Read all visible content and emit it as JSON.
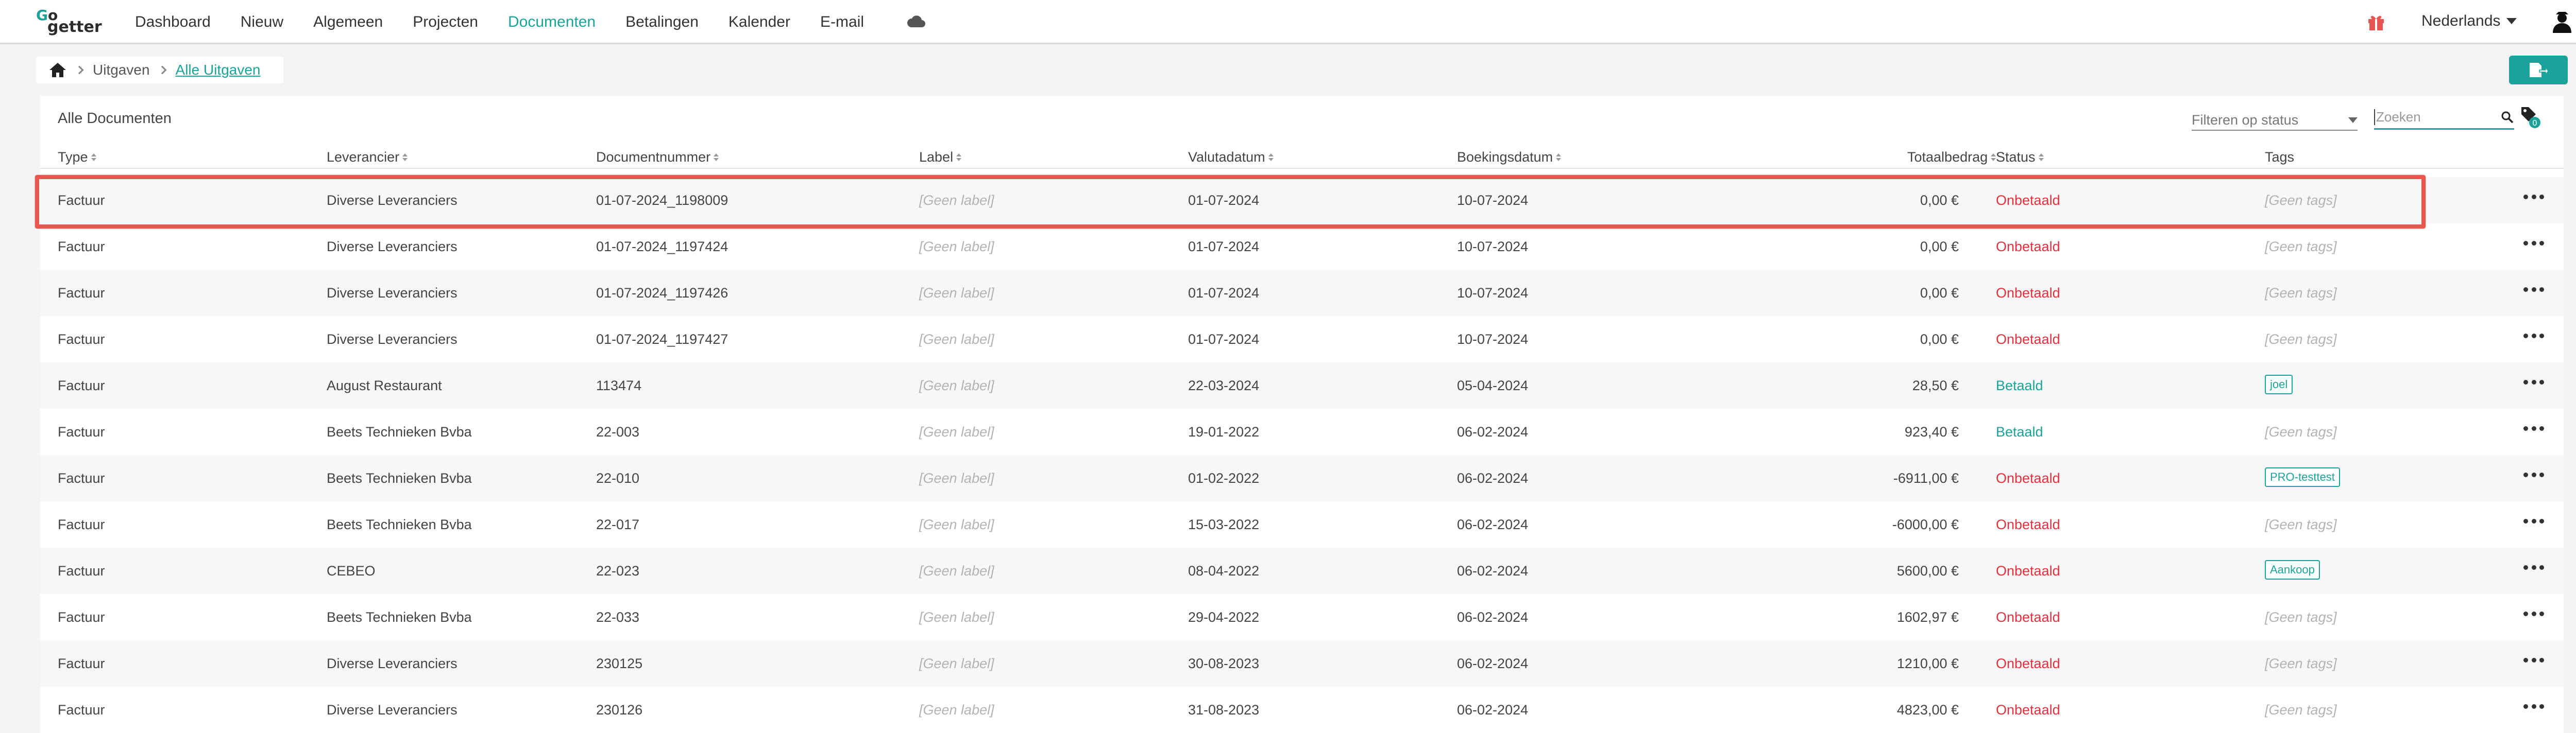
{
  "colors": {
    "accent": "#1aa39a",
    "unpaid": "#e2303e",
    "highlight": "#e85652"
  },
  "logo": {
    "line1_prefix": "G",
    "line1": "o",
    "line2": "getter"
  },
  "nav": {
    "items": [
      {
        "label": "Dashboard",
        "active": false
      },
      {
        "label": "Nieuw",
        "active": false
      },
      {
        "label": "Algemeen",
        "active": false
      },
      {
        "label": "Projecten",
        "active": false
      },
      {
        "label": "Documenten",
        "active": true
      },
      {
        "label": "Betalingen",
        "active": false
      },
      {
        "label": "Kalender",
        "active": false
      },
      {
        "label": "E-mail",
        "active": false
      }
    ],
    "cloud_icon": "cloud-icon",
    "gift_icon": "gift-icon",
    "language": "Nederlands",
    "user_icon": "user-icon"
  },
  "breadcrumb": {
    "home_icon": "home-icon",
    "items": [
      "Uitgaven",
      "Alle Uitgaven"
    ]
  },
  "export_icon": "export-icon",
  "card": {
    "title": "Alle Documenten",
    "filter_placeholder": "Filteren op status",
    "search_placeholder": "Zoeken",
    "tag_filter_count": "0"
  },
  "table": {
    "headers": [
      "Type",
      "Leverancier",
      "Documentnummer",
      "Label",
      "Valutadatum",
      "Boekingsdatum",
      "Totaalbedrag",
      "Status",
      "Tags"
    ],
    "rows": [
      {
        "type": "Factuur",
        "leverancier": "Diverse Leveranciers",
        "doc": "01-07-2024_1198009",
        "label": "[Geen label]",
        "valuta": "01-07-2024",
        "boeking": "10-07-2024",
        "totaal": "0,00 €",
        "status": "Onbetaald",
        "paid": false,
        "tag": "[Geen tags]",
        "has_tag": false
      },
      {
        "type": "Factuur",
        "leverancier": "Diverse Leveranciers",
        "doc": "01-07-2024_1197424",
        "label": "[Geen label]",
        "valuta": "01-07-2024",
        "boeking": "10-07-2024",
        "totaal": "0,00 €",
        "status": "Onbetaald",
        "paid": false,
        "tag": "[Geen tags]",
        "has_tag": false
      },
      {
        "type": "Factuur",
        "leverancier": "Diverse Leveranciers",
        "doc": "01-07-2024_1197426",
        "label": "[Geen label]",
        "valuta": "01-07-2024",
        "boeking": "10-07-2024",
        "totaal": "0,00 €",
        "status": "Onbetaald",
        "paid": false,
        "tag": "[Geen tags]",
        "has_tag": false
      },
      {
        "type": "Factuur",
        "leverancier": "Diverse Leveranciers",
        "doc": "01-07-2024_1197427",
        "label": "[Geen label]",
        "valuta": "01-07-2024",
        "boeking": "10-07-2024",
        "totaal": "0,00 €",
        "status": "Onbetaald",
        "paid": false,
        "tag": "[Geen tags]",
        "has_tag": false
      },
      {
        "type": "Factuur",
        "leverancier": "August Restaurant",
        "doc": "113474",
        "label": "[Geen label]",
        "valuta": "22-03-2024",
        "boeking": "05-04-2024",
        "totaal": "28,50 €",
        "status": "Betaald",
        "paid": true,
        "tag": "joel",
        "has_tag": true
      },
      {
        "type": "Factuur",
        "leverancier": "Beets Technieken Bvba",
        "doc": "22-003",
        "label": "[Geen label]",
        "valuta": "19-01-2022",
        "boeking": "06-02-2024",
        "totaal": "923,40 €",
        "status": "Betaald",
        "paid": true,
        "tag": "[Geen tags]",
        "has_tag": false
      },
      {
        "type": "Factuur",
        "leverancier": "Beets Technieken Bvba",
        "doc": "22-010",
        "label": "[Geen label]",
        "valuta": "01-02-2022",
        "boeking": "06-02-2024",
        "totaal": "-6911,00 €",
        "status": "Onbetaald",
        "paid": false,
        "tag": "PRO-testtest",
        "has_tag": true
      },
      {
        "type": "Factuur",
        "leverancier": "Beets Technieken Bvba",
        "doc": "22-017",
        "label": "[Geen label]",
        "valuta": "15-03-2022",
        "boeking": "06-02-2024",
        "totaal": "-6000,00 €",
        "status": "Onbetaald",
        "paid": false,
        "tag": "[Geen tags]",
        "has_tag": false
      },
      {
        "type": "Factuur",
        "leverancier": "CEBEO",
        "doc": "22-023",
        "label": "[Geen label]",
        "valuta": "08-04-2022",
        "boeking": "06-02-2024",
        "totaal": "5600,00 €",
        "status": "Onbetaald",
        "paid": false,
        "tag": "Aankoop",
        "has_tag": true
      },
      {
        "type": "Factuur",
        "leverancier": "Beets Technieken Bvba",
        "doc": "22-033",
        "label": "[Geen label]",
        "valuta": "29-04-2022",
        "boeking": "06-02-2024",
        "totaal": "1602,97 €",
        "status": "Onbetaald",
        "paid": false,
        "tag": "[Geen tags]",
        "has_tag": false
      },
      {
        "type": "Factuur",
        "leverancier": "Diverse Leveranciers",
        "doc": "230125",
        "label": "[Geen label]",
        "valuta": "30-08-2023",
        "boeking": "06-02-2024",
        "totaal": "1210,00 €",
        "status": "Onbetaald",
        "paid": false,
        "tag": "[Geen tags]",
        "has_tag": false
      },
      {
        "type": "Factuur",
        "leverancier": "Diverse Leveranciers",
        "doc": "230126",
        "label": "[Geen label]",
        "valuta": "31-08-2023",
        "boeking": "06-02-2024",
        "totaal": "4823,00 €",
        "status": "Onbetaald",
        "paid": false,
        "tag": "[Geen tags]",
        "has_tag": false
      }
    ],
    "row_action_icon": "more-horizontal-icon",
    "highlighted_row": 0
  }
}
